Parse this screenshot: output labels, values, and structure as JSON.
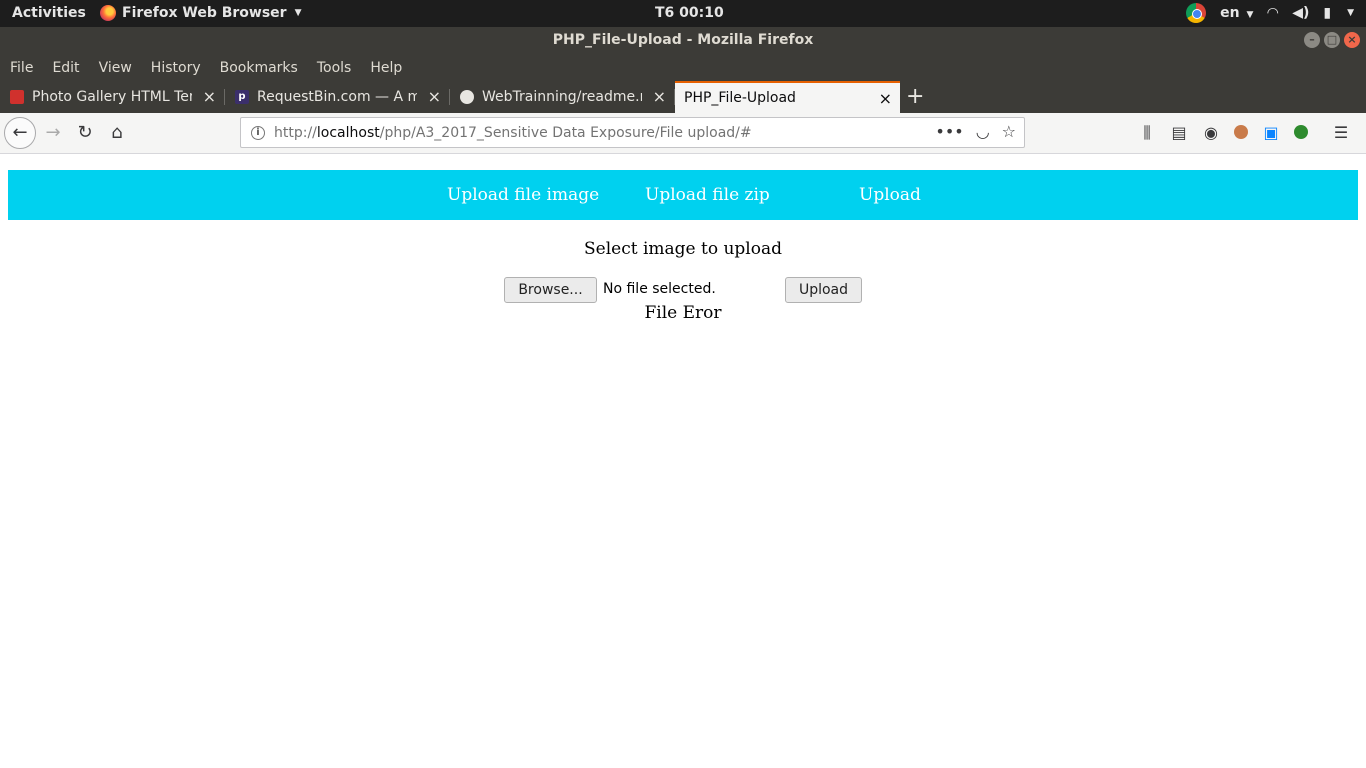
{
  "topbar": {
    "activities": "Activities",
    "app_menu": "Firefox Web Browser",
    "clock": "T6 00:10",
    "language": "en"
  },
  "window": {
    "title": "PHP_File-Upload - Mozilla Firefox"
  },
  "menubar": [
    "File",
    "Edit",
    "View",
    "History",
    "Bookmarks",
    "Tools",
    "Help"
  ],
  "tabs": [
    {
      "label": "Photo Gallery HTML Tem",
      "favicon_color": "#d0312d"
    },
    {
      "label": "RequestBin.com — A mo",
      "favicon_color": "#3b2f6b"
    },
    {
      "label": "WebTrainning/readme.m",
      "favicon_color": "#1b1f23"
    },
    {
      "label": "PHP_File-Upload",
      "favicon_color": "",
      "active": true
    }
  ],
  "navbar": {
    "url_prefix": "http://",
    "url_host": "localhost",
    "url_path": "/php/A3_2017_Sensitive Data Exposure/File upload/#"
  },
  "page": {
    "nav_links": [
      "Upload file image",
      "Upload file zip",
      "Upload"
    ],
    "heading": "Select image to upload",
    "browse_label": "Browse...",
    "file_status": "No file selected.",
    "upload_label": "Upload",
    "error_text": "File Eror"
  },
  "colors": {
    "nav_background": "#00d1ef",
    "tab_active_accent": "#e66000"
  }
}
